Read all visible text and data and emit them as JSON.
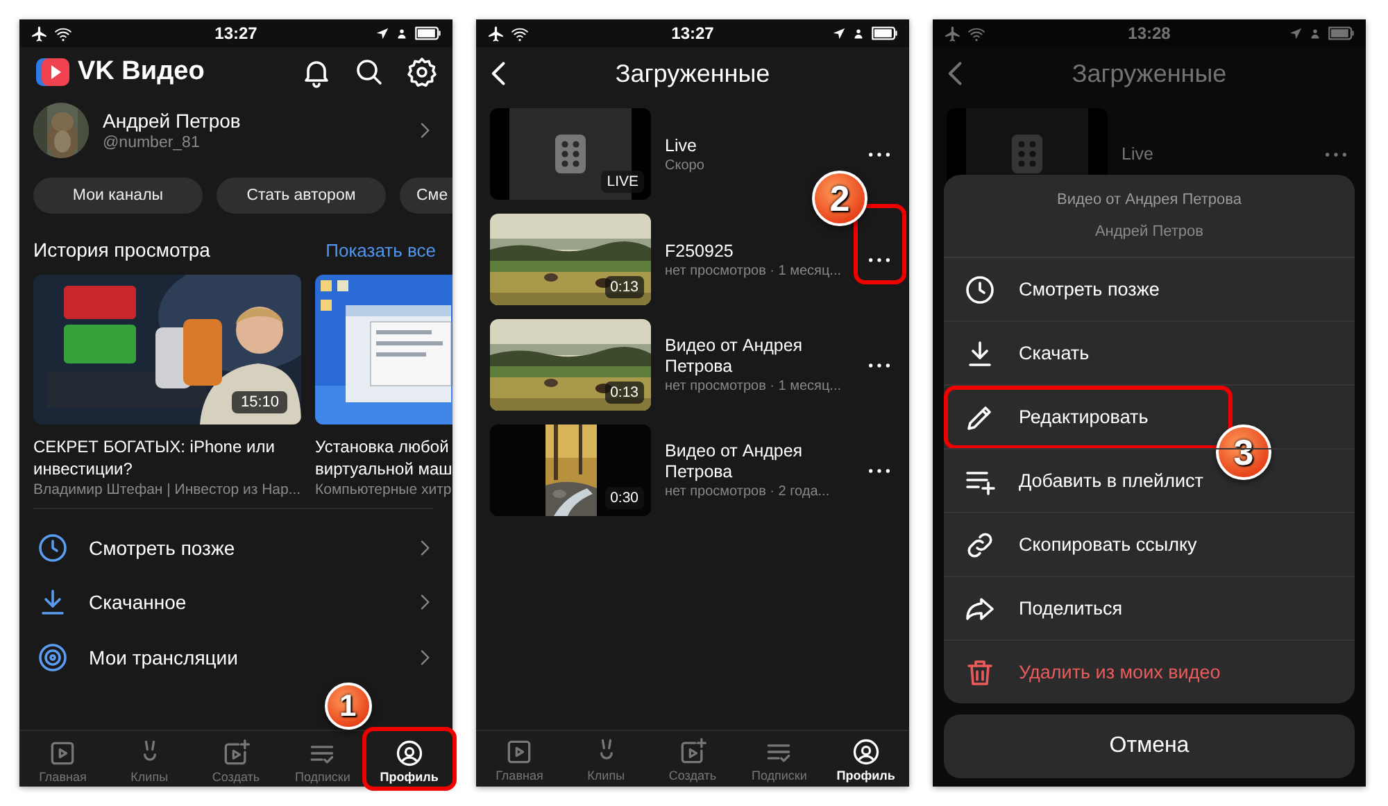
{
  "profile_screen": {
    "status_bar": {
      "time": "13:27"
    },
    "app_title": "VK Видео",
    "user": {
      "name": "Андрей Петров",
      "handle": "@number_81"
    },
    "chips": [
      "Мои каналы",
      "Стать автором",
      "Сме"
    ],
    "history": {
      "title": "История просмотра",
      "show_all": "Показать все",
      "videos": [
        {
          "title": "СЕКРЕТ БОГАТЫХ: iPhone или инвестиции?",
          "channel": "Владимир Штефан | Инвестор из Нар...",
          "duration": "15:10"
        },
        {
          "title": "Установка любой виртуальной маш",
          "channel": "Компьютерные хитр"
        }
      ]
    },
    "menu": [
      {
        "label": "Смотреть позже",
        "kind": "clock"
      },
      {
        "label": "Скачанное",
        "kind": "download"
      },
      {
        "label": "Мои трансляции",
        "kind": "broadcast"
      }
    ],
    "tab_bar": [
      {
        "label": "Главная",
        "kind": "home",
        "selected": false
      },
      {
        "label": "Клипы",
        "kind": "clips",
        "selected": false
      },
      {
        "label": "Создать",
        "kind": "create",
        "selected": false
      },
      {
        "label": "Подписки",
        "kind": "subs",
        "selected": false
      },
      {
        "label": "Профиль",
        "kind": "profile",
        "selected": true,
        "callout": "1"
      }
    ]
  },
  "uploads_screen": {
    "status_bar": {
      "time": "13:27"
    },
    "title": "Загруженные",
    "videos": [
      {
        "kind": "live",
        "title": "Live",
        "meta": "Скоро",
        "badge": "LIVE"
      },
      {
        "kind": "video",
        "title": "F250925",
        "meta": "нет просмотров · 1 месяц...",
        "duration": "0:13",
        "callout": "2"
      },
      {
        "kind": "video",
        "title": "Видео от Андрея Петрова",
        "meta": "нет просмотров · 1 месяц...",
        "duration": "0:13"
      },
      {
        "kind": "video",
        "title": "Видео от Андрея Петрова",
        "meta": "нет просмотров · 2 года...",
        "duration": "0:30"
      }
    ],
    "tab_bar": [
      {
        "label": "Главная",
        "kind": "home",
        "selected": false
      },
      {
        "label": "Клипы",
        "kind": "clips",
        "selected": false
      },
      {
        "label": "Создать",
        "kind": "create",
        "selected": false
      },
      {
        "label": "Подписки",
        "kind": "subs",
        "selected": false
      },
      {
        "label": "Профиль",
        "kind": "profile",
        "selected": true
      }
    ]
  },
  "menu_screen": {
    "status_bar": {
      "time": "13:28"
    },
    "title": "Загруженные",
    "videos": [
      {
        "kind": "live",
        "title": "Live"
      }
    ],
    "sheet": {
      "title": "Видео от Андрея Петрова",
      "subtitle": "Андрей Петров",
      "actions": [
        {
          "label": "Смотреть позже",
          "kind": "clock"
        },
        {
          "label": "Скачать",
          "kind": "download"
        },
        {
          "label": "Редактировать",
          "kind": "edit",
          "callout": "3"
        },
        {
          "label": "Добавить в плейлист",
          "kind": "playlist"
        },
        {
          "label": "Скопировать ссылку",
          "kind": "copy_link"
        },
        {
          "label": "Поделиться",
          "kind": "share"
        },
        {
          "label": "Удалить из моих видео",
          "kind": "delete"
        }
      ],
      "cancel": "Отмена"
    }
  }
}
